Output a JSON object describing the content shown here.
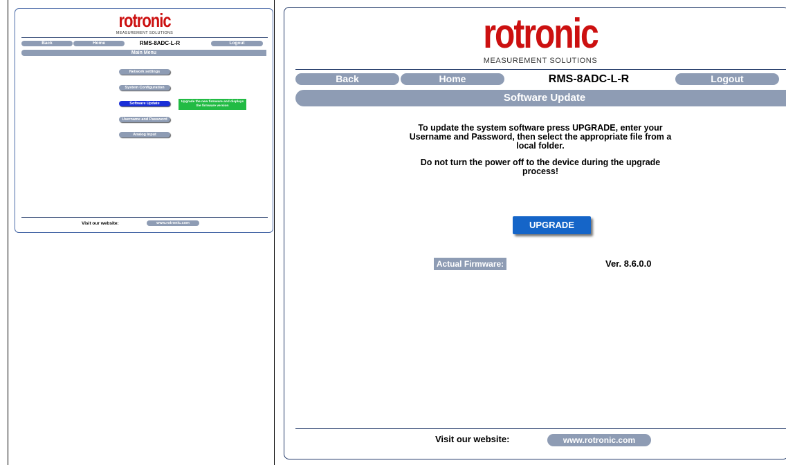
{
  "brand": {
    "name": "rotronic",
    "tagline": "MEASUREMENT SOLUTIONS",
    "logo_color": "#cc1010"
  },
  "colors": {
    "pill_gray": "#8e9cb4",
    "active_blue": "#1a2fd8",
    "upgrade_blue": "#1565c8",
    "tooltip_green": "#22bb44",
    "frame_navy": "#1d3566"
  },
  "small_panel": {
    "nav": {
      "back": "Back",
      "home": "Home",
      "device": "RMS-8ADC-L-R",
      "logout": "Logout"
    },
    "section_title": "Main Menu",
    "menu": [
      {
        "label": "Network settings",
        "active": false
      },
      {
        "label": "System Configuration",
        "active": false
      },
      {
        "label": "Software Update",
        "active": true
      },
      {
        "label": "Username and Password",
        "active": false
      },
      {
        "label": "Analog Input",
        "active": false
      }
    ],
    "tooltip": "Upgrade the new firmware and displays the firmware version",
    "footer": {
      "label": "Visit our website:",
      "link": "www.rotronic.com"
    }
  },
  "big_panel": {
    "nav": {
      "back": "Back",
      "home": "Home",
      "device": "RMS-8ADC-L-R",
      "logout": "Logout"
    },
    "section_title": "Software Update",
    "message_1": "To update the system software press UPGRADE, enter your Username and Password, then select the appropriate file from a local folder.",
    "message_2": "Do not turn the power off to the device during the upgrade process!",
    "upgrade_button": "UPGRADE",
    "firmware_label": "Actual Firmware:",
    "firmware_version": "Ver. 8.6.0.0",
    "footer": {
      "label": "Visit our website:",
      "link": "www.rotronic.com"
    }
  }
}
